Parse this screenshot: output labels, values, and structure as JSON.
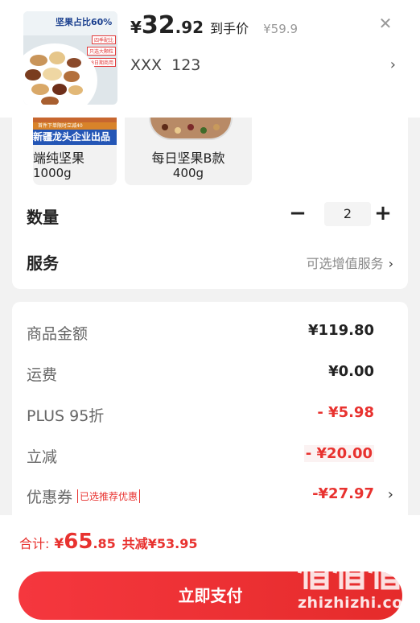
{
  "product": {
    "image_title": "坚果占比60%",
    "image_tags": [
      "四季配比",
      "只选大颗粒",
      "日鲜8日期商用"
    ],
    "price_yen": "¥",
    "price_int": "32",
    "price_dec": ".92",
    "price_suffix": "到手价",
    "original_price": "¥59.9",
    "spec": "XXX  123"
  },
  "variants": [
    {
      "name": "端纯坚果",
      "weight": "1000g",
      "promo": "首件下单限时立减40",
      "banner": "新疆龙头企业出品"
    },
    {
      "name": "每日坚果B款",
      "weight": "400g"
    }
  ],
  "quantity": {
    "label": "数量",
    "value": "2",
    "minus": "−",
    "plus": "+"
  },
  "service": {
    "label": "服务",
    "link": "可选增值服务"
  },
  "summary": [
    {
      "label": "商品金额",
      "value": "¥119.80"
    },
    {
      "label": "运费",
      "value": "¥0.00"
    },
    {
      "label": "PLUS 95折",
      "value": "- ¥5.98"
    },
    {
      "label": "立减",
      "value": "- ¥20.00"
    },
    {
      "label": "优惠券",
      "tag": "已选推荐优惠",
      "value": "-¥27.97"
    }
  ],
  "footer": {
    "total_label": "合计:",
    "yen": "¥",
    "total_int": "65",
    "total_dec": ".85",
    "saving": "共减¥53.95",
    "pay_button": "立即支付"
  },
  "watermark": {
    "text": "zhizhizhi.com"
  },
  "colors": {
    "accent": "#e8322f",
    "brand_blue": "#2456b6"
  },
  "icons": {
    "close": "close-icon",
    "chevron": "chevron-right-icon"
  }
}
